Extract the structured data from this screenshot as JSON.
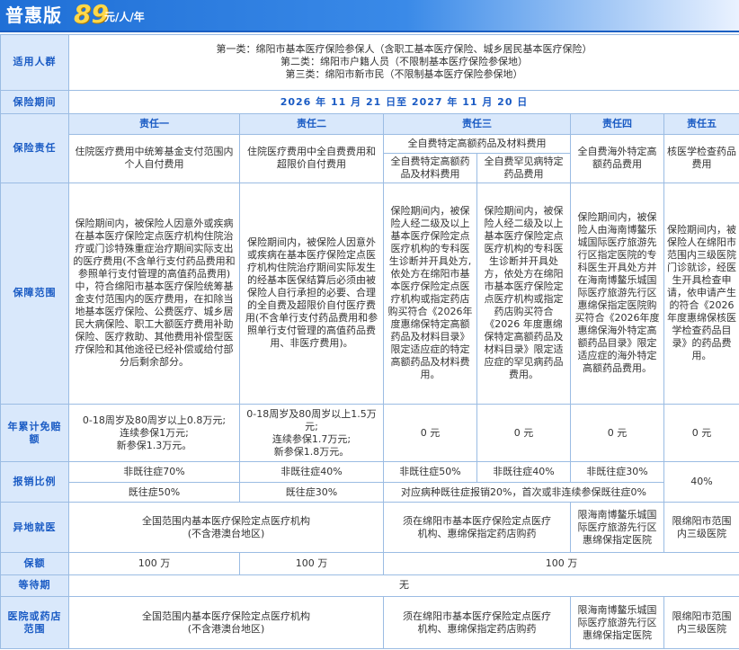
{
  "banner": {
    "title": "普惠版",
    "price": "89",
    "unit": "元/人/年"
  },
  "labels": {
    "applicable": "适用人群",
    "period": "保险期间",
    "responsibility": "保险责任",
    "scope": "保障范围",
    "deductible": "年累计免赔额",
    "ratio": "报销比例",
    "offsite": "异地就医",
    "amount": "保额",
    "waiting": "等待期",
    "hospitals": "医院或药店范围"
  },
  "groups": [
    "第一类：绵阳市基本医疗保险参保人（含职工基本医疗保险、城乡居民基本医疗保险）",
    "第二类：绵阳市户籍人员（不限制基本医疗保险参保地）",
    "第三类：绵阳市新市民（不限制基本医疗保险参保地）"
  ],
  "period": "2026 年 11 月 21 日至 2027 年 11 月 20 日",
  "headers": [
    "责任一",
    "责任二",
    "责任三",
    "责任四",
    "责任五"
  ],
  "resp": {
    "r1": "住院医疗费用中统筹基金支付范围内个人自付费用",
    "r2": "住院医疗费用中全自费费用和超限价自付费用",
    "r3": "全自费特定高额药品及材料费用",
    "r3a": "全自费特定高额药品及材料费用",
    "r3b": "全自费罕见病特定药品费用",
    "r4": "全自费海外特定高额药品费用",
    "r5": "核医学检查药品费用"
  },
  "scope": {
    "s1": "保险期间内，被保险人因意外或疾病在基本医疗保险定点医疗机构住院治疗或门诊特殊重症治疗期间实际支出的医疗费用(不含单行支付药品费用和参照单行支付管理的高值药品费用)中，符合绵阳市基本医疗保险统筹基金支付范围内的医疗费用，在扣除当地基本医疗保险、公费医疗、城乡居民大病保险、职工大额医疗费用补助保险、医疗救助、其他费用补偿型医疗保险和其他途径已经补偿或给付部分后剩余部分。",
    "s2": "保险期间内，被保险人因意外或疾病在基本医疗保险定点医疗机构住院治疗期间实际发生的经基本医保结算后必须由被保险人自行承担的必要、合理的全自费及超限价自付医疗费用(不含单行支付药品费用和参照单行支付管理的高值药品费用、非医疗费用)。",
    "s3a": "保险期间内，被保险人经二级及以上基本医疗保险定点医疗机构的专科医生诊断并开具处方,依处方在绵阳市基本医疗保险定点医疗机构或指定药店购买符合《2026年度惠绵保特定高额药品及材料目录》限定适应症的特定高额药品及材料费用。",
    "s3b": "保险期间内，被保险人经二级及以上基本医疗保险定点医疗机构的专科医生诊断并开具处方，依处方在绵阳市基本医疗保险定点医疗机构或指定药店购买符合《2026 年度惠绵保特定高额药品及材料目录》限定适应症的罕见病药品费用。",
    "s4": "保险期间内，被保险人由海南博鳌乐城国际医疗旅游先行区指定医院的专科医生开具处方并在海南博鳌乐城国际医疗旅游先行区惠绵保指定医院购买符合《2026年度惠绵保海外特定高额药品目录》限定适应症的海外特定高额药品费用。",
    "s5": "保险期间内，被保险人在绵阳市范围内三级医院门诊就诊，经医生开具检查申请，依申请产生的符合《2026年度惠绵保核医学检查药品目录》的药品费用。"
  },
  "deductible": {
    "d1": [
      "0-18周岁及80周岁以上0.8万元;",
      "连续参保1万元;",
      "新参保1.3万元。"
    ],
    "d2": [
      "0-18周岁及80周岁以上1.5万元;",
      "连续参保1.7万元;",
      "新参保1.8万元。"
    ],
    "d3a": "0 元",
    "d3b": "0 元",
    "d4": "0 元",
    "d5": "0 元"
  },
  "ratio": {
    "r1a": "非既往症70%",
    "r1b": "既往症50%",
    "r2a": "非既往症40%",
    "r2b": "既往症30%",
    "r3a": "非既往症50%",
    "r3b": "非既往症40%",
    "r4a": "非既往症30%",
    "pre3to4": "对应病种既往症报销20%，首次或非连续参保既往症0%",
    "r5": "40%"
  },
  "offsite": {
    "o12": [
      "全国范围内基本医疗保险定点医疗机构",
      "(不含港澳台地区)"
    ],
    "o3": [
      "须在绵阳市基本医疗保险定点医疗",
      "机构、惠绵保指定药店购药"
    ],
    "o4": [
      "限海南博鳌乐城国",
      "际医疗旅游先行区",
      "惠绵保指定医院"
    ],
    "o5": [
      "限绵阳市范围",
      "内三级医院"
    ]
  },
  "amount": {
    "a1": "100 万",
    "a2": "100 万",
    "a3": "100 万"
  },
  "waiting": "无",
  "hospitals": {
    "h12": [
      "全国范围内基本医疗保险定点医疗机构",
      "(不含港澳台地区)"
    ],
    "h3": [
      "须在绵阳市基本医疗保险定点医疗",
      "机构、惠绵保指定药店购药"
    ],
    "h4": [
      "限海南博鳌乐城国",
      "际医疗旅游先行区",
      "惠绵保指定医院"
    ],
    "h5": [
      "限绵阳市范围",
      "内三级医院"
    ]
  }
}
